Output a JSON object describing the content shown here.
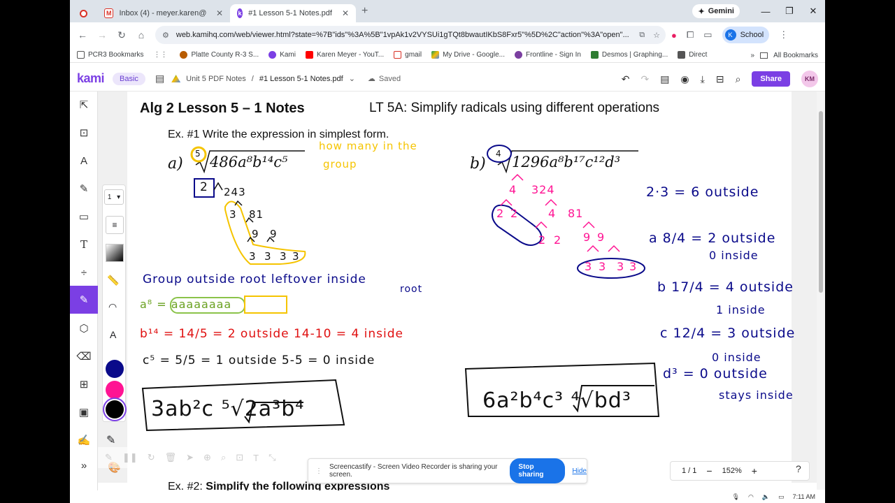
{
  "browser": {
    "tabs": [
      {
        "title": "",
        "icon": "record-icon"
      },
      {
        "title": "Inbox (4) - meyer.karen@pcr3s",
        "icon": "gmail-icon"
      },
      {
        "title": "#1 Lesson 5-1 Notes.pdf",
        "icon": "kami-icon"
      }
    ],
    "gemini": "Gemini",
    "url": "web.kamihq.com/web/viewer.html?state=%7B\"ids\"%3A%5B\"1vpAk1v2VYSUi1gTQt8bwautIKbS8Fxr5\"%5D%2C\"action\"%3A\"open\"...",
    "profile": "School",
    "profile_initial": "K",
    "bookmarks": [
      "PCR3 Bookmarks",
      "Platte County R-3 S...",
      "Kami",
      "Karen Meyer - YouT...",
      "gmail",
      "My Drive - Google...",
      "Frontline - Sign In",
      "Desmos | Graphing...",
      "Direct"
    ],
    "all_bookmarks": "All Bookmarks"
  },
  "kami": {
    "logo": "kami",
    "plan": "Basic",
    "breadcrumb_parent": "Unit 5 PDF Notes",
    "breadcrumb_sep": "/",
    "breadcrumb_current": "#1 Lesson 5-1 Notes.pdf",
    "saved": "Saved",
    "share": "Share",
    "avatar": "KM",
    "page_select": "1",
    "colors": [
      "#0a0a8a",
      "#ff1493",
      "#000000"
    ]
  },
  "document": {
    "title": "Alg 2 Lesson 5 – 1 Notes",
    "lt": "LT 5A:  Simplify radicals using different operations",
    "ex1": "Ex. #1 Write the expression in simplest form.",
    "ex2_prefix": "Ex. #2:",
    "ex2_text": "Simplify the following expressions",
    "a_label": "a)",
    "a_expr": "486a⁸b¹⁴c⁵",
    "b_label": "b)",
    "b_expr": "1296a⁸b¹⁷c¹²d³"
  },
  "handwriting": {
    "index5": "5",
    "index4": "4",
    "how_many_1": "how many in the",
    "how_many_2": "group",
    "tree_a": [
      "2",
      "243",
      "3",
      "81",
      "9",
      "9",
      "3",
      "3",
      "3",
      "3"
    ],
    "tree_b": [
      "4",
      "324",
      "2",
      "2",
      "4",
      "81",
      "2",
      "2",
      "9",
      "9",
      "3",
      "3",
      "3",
      "3"
    ],
    "group_note": "Group outside root  leftover inside",
    "group_note2": "root",
    "a8_line": "a⁸ = aaaaaaaa",
    "b14_line": "b¹⁴ = 14/5 = 2 outside  14-10 = 4 inside",
    "c5_line": "c⁵ = 5/5 = 1 outside  5-5 = 0 inside",
    "answer_a": "3ab²c ⁵√2a³b⁴",
    "answer_b": "6a²b⁴c³ ⁴√bd³",
    "right_notes": [
      "2·3 = 6 outside",
      "a 8/4 = 2 outside",
      "0 inside",
      "b 17/4 = 4 outside",
      "1 inside",
      "c 12/4 = 3 outside",
      "0 inside",
      "d³ = 0 outside",
      "stays inside"
    ]
  },
  "overlay": {
    "cast_msg": "Screencastify - Screen Video Recorder is sharing your screen.",
    "stop": "Stop sharing",
    "hide": "Hide",
    "page": "1 / 1",
    "minus": "−",
    "zoom": "152%",
    "plus": "+",
    "help": "?"
  },
  "taskbar": {
    "time": "7:11 AM"
  }
}
